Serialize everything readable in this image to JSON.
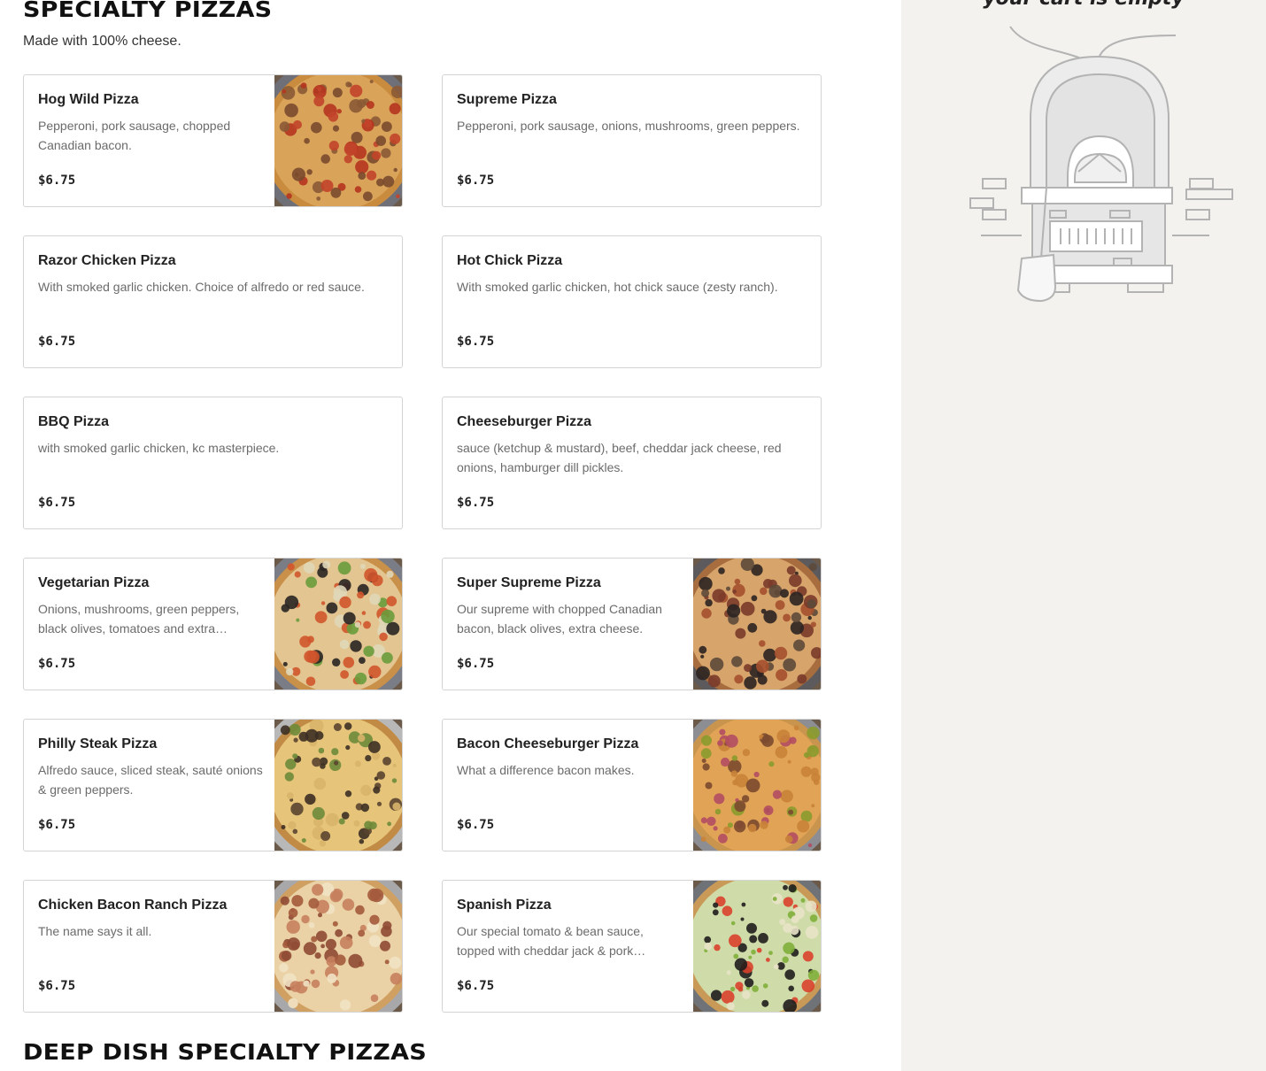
{
  "specialty": {
    "title": "SPECIALTY PIZZAS",
    "subtitle": "Made with 100% cheese.",
    "items": [
      {
        "name": "Hog Wild Pizza",
        "desc": "Pepperoni, pork sausage, chopped Canadian bacon.",
        "price": "$6.75",
        "image": "pepperoni-sausage-pizza"
      },
      {
        "name": "Supreme Pizza",
        "desc": "Pepperoni, pork sausage, onions, mushrooms, green peppers.",
        "price": "$6.75",
        "image": null
      },
      {
        "name": "Razor Chicken Pizza",
        "desc": "With smoked garlic chicken. Choice of alfredo or red sauce.",
        "price": "$6.75",
        "image": null
      },
      {
        "name": "Hot Chick Pizza",
        "desc": "With smoked garlic chicken, hot chick sauce (zesty ranch).",
        "price": "$6.75",
        "image": null
      },
      {
        "name": "BBQ Pizza",
        "desc": "with smoked garlic chicken, kc masterpiece.",
        "price": "$6.75",
        "image": null
      },
      {
        "name": "Cheeseburger Pizza",
        "desc": "sauce (ketchup & mustard), beef, cheddar jack cheese, red onions, hamburger dill pickles.",
        "price": "$6.75",
        "image": null
      },
      {
        "name": "Vegetarian Pizza",
        "desc": "Onions, mushrooms, green peppers, black olives, tomatoes and extra…",
        "price": "$6.75",
        "image": "vegetarian-pizza"
      },
      {
        "name": "Super Supreme Pizza",
        "desc": "Our supreme with chopped Canadian bacon, black olives, extra cheese.",
        "price": "$6.75",
        "image": "super-supreme-pizza"
      },
      {
        "name": "Philly Steak Pizza",
        "desc": "Alfredo sauce, sliced steak, sauté onions & green peppers.",
        "price": "$6.75",
        "image": "philly-steak-pizza"
      },
      {
        "name": "Bacon Cheeseburger Pizza",
        "desc": "What a difference bacon makes.",
        "price": "$6.75",
        "image": "bacon-cheeseburger-pizza"
      },
      {
        "name": "Chicken Bacon Ranch Pizza",
        "desc": "The name says it all.",
        "price": "$6.75",
        "image": "chicken-bacon-ranch-pizza"
      },
      {
        "name": "Spanish Pizza",
        "desc": "Our special tomato & bean sauce, topped with cheddar jack & pork…",
        "price": "$6.75",
        "image": "spanish-pizza"
      }
    ]
  },
  "deep_dish": {
    "title": "DEEP DISH SPECIALTY PIZZAS"
  },
  "cart": {
    "empty_text": "your cart is empty",
    "illustration": "pizza-oven-illustration"
  },
  "colors": {
    "sidebar_bg": "#f3f2ef",
    "card_border": "#d4d4d4",
    "desc_text": "#6b6b6b"
  }
}
